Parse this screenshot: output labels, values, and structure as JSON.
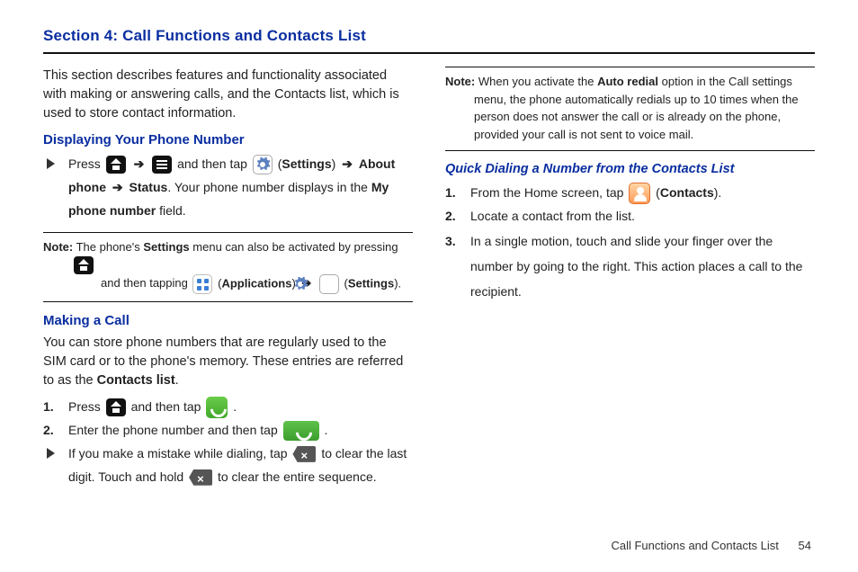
{
  "section_title": "Section 4: Call Functions and Contacts List",
  "left": {
    "intro": "This section describes features and functionality associated with making or answering calls, and the Contacts list, which is used to store contact information.",
    "h_display": "Displaying Your Phone Number",
    "display_item": {
      "press": "Press",
      "and_tap": "and then tap",
      "settings": "Settings",
      "about": "About phone",
      "status": "Status",
      "rest": ". Your phone number displays in the ",
      "myphone": "My phone number",
      "field": " field."
    },
    "note1": {
      "label": "Note:",
      "line1": "The phone's ",
      "settings": "Settings",
      "line2": " menu can also be activated by pressing ",
      "line3": "and then tapping ",
      "apps": "Applications",
      "settings2": "Settings"
    },
    "h_making": "Making a Call",
    "making_intro_a": "You can store phone numbers that are regularly used to the SIM card or to the phone's memory. These entries are referred to as the ",
    "making_intro_b": "Contacts list",
    "steps": {
      "s1a": "Press",
      "s1b": "and then tap",
      "s2a": "Enter the phone number and then tap",
      "s3a": "If you make a mistake while dialing, tap",
      "s3b": "to clear the last digit. Touch and hold",
      "s3c": "to clear the entire sequence."
    }
  },
  "right": {
    "note2": {
      "label": "Note:",
      "text_a": "When you activate the ",
      "auto": "Auto redial",
      "text_b": " option in the Call settings menu, the phone automatically redials up to 10 times when the person does not answer the call or is already on the phone, provided your call is not sent to voice mail."
    },
    "h_quick": "Quick Dialing a Number from the Contacts List",
    "q1a": "From the Home screen, tap",
    "q1b": "Contacts",
    "q2": "Locate a contact from the list.",
    "q3": "In a single motion, touch and slide your finger over the number by going to the right. This action places a call to the recipient."
  },
  "footer": {
    "text": "Call Functions and Contacts List",
    "page": "54"
  }
}
